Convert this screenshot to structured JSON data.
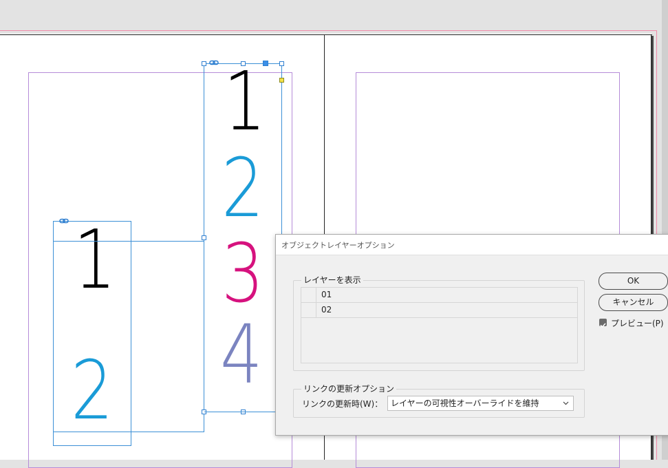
{
  "document": {
    "left_frame_digits": [
      {
        "text": "1",
        "color": "#000000"
      },
      {
        "text": "2",
        "color": "#1a9bd7"
      }
    ],
    "right_frame_digits": [
      {
        "text": "1",
        "color": "#000000"
      },
      {
        "text": "2",
        "color": "#1a9bd7"
      },
      {
        "text": "3",
        "color": "#d6127e"
      },
      {
        "text": "4",
        "color": "#7b84c0"
      }
    ]
  },
  "dialog": {
    "title": "オブジェクトレイヤーオプション",
    "layers_group_label": "レイヤーを表示",
    "layers": [
      {
        "name": "01"
      },
      {
        "name": "02"
      }
    ],
    "update_group_label": "リンクの更新オプション",
    "update_field_label": "リンクの更新時(W)：",
    "update_select_value": "レイヤーの可視性オーバーライドを維持",
    "ok_label": "OK",
    "cancel_label": "キャンセル",
    "preview_label": "プレビュー(P)",
    "preview_checked": true
  },
  "icons": {
    "link": "link-icon",
    "checkbox": "checkmark-icon",
    "dropdown": "chevron-down-icon"
  }
}
